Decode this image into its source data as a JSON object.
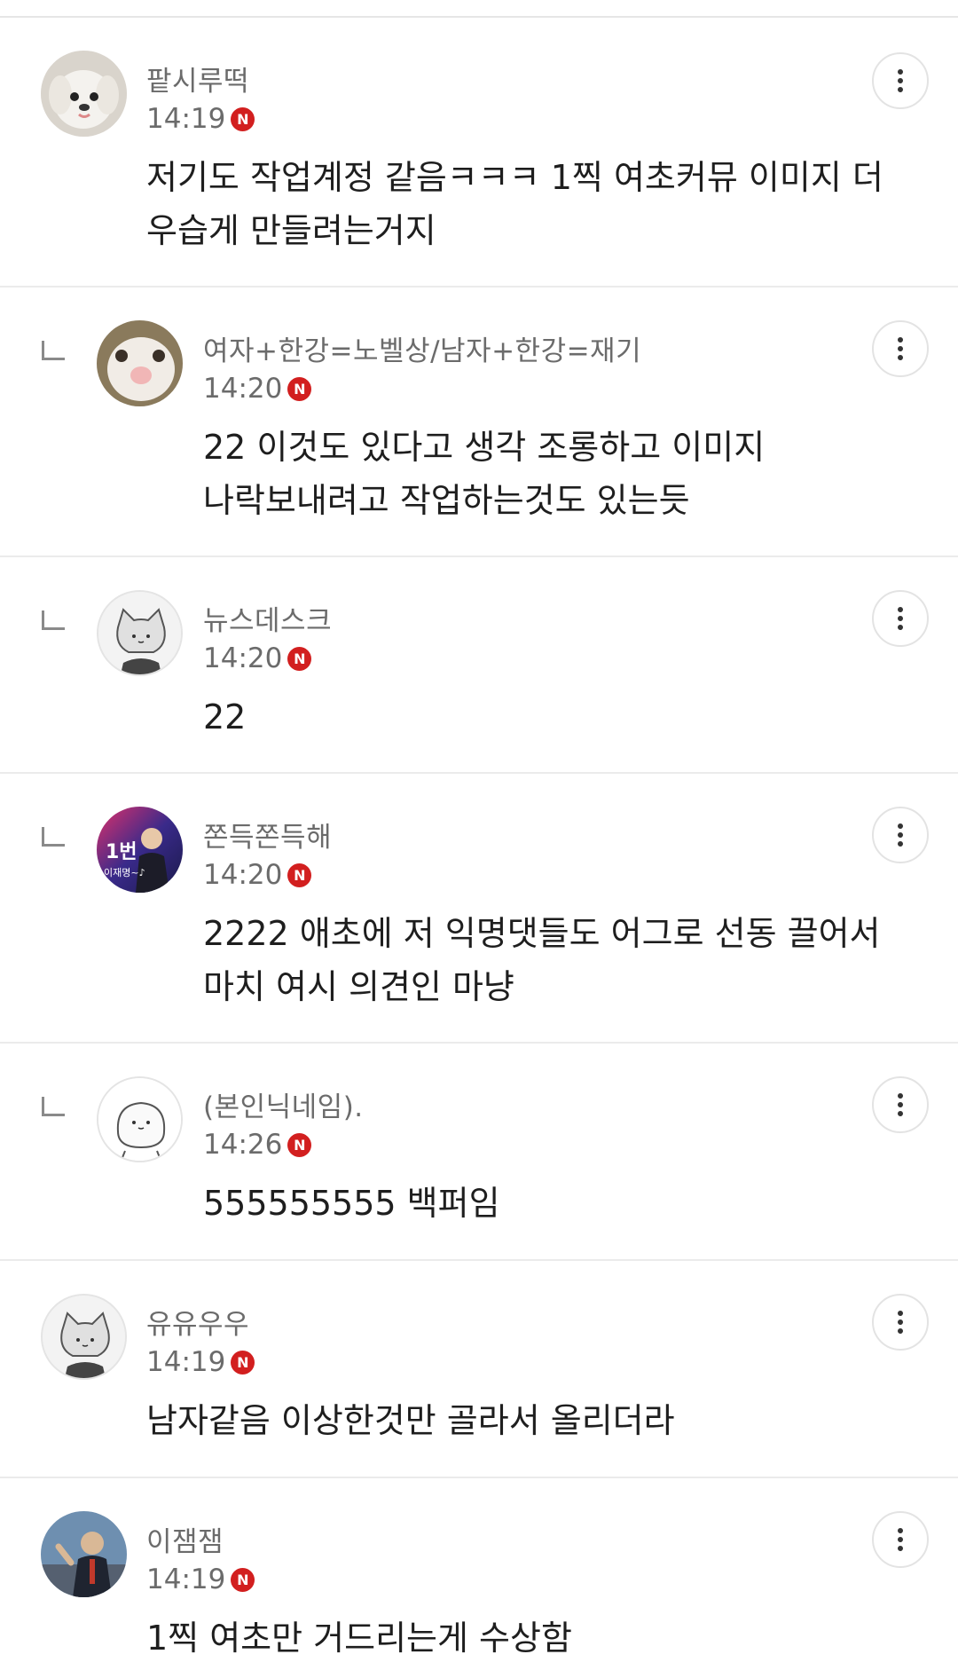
{
  "comments": [
    {
      "author": "팥시루떡",
      "time": "14:19",
      "badge": "N",
      "lines": [
        "저기도 작업계정 같음ㅋㅋㅋ 1찍 여초커뮤 이미지 더",
        "우습게 만들려는거지"
      ]
    },
    {
      "author": "여자+한강=노벨상/남자+한강=재기",
      "time": "14:20",
      "badge": "N",
      "lines": [
        "22 이것도 있다고 생각 조롱하고 이미지",
        "나락보내려고 작업하는것도 있는듯"
      ]
    },
    {
      "author": "뉴스데스크",
      "time": "14:20",
      "badge": "N",
      "lines": [
        "22"
      ]
    },
    {
      "author": "쫀득쫀득해",
      "time": "14:20",
      "badge": "N",
      "lines": [
        "2222 애초에 저 익명댓들도 어그로 선동 끌어서",
        "마치 여시 의견인 마냥"
      ]
    },
    {
      "author": "(본인닉네임).",
      "time": "14:26",
      "badge": "N",
      "lines": [
        "555555555 백퍼임"
      ]
    },
    {
      "author": "유유우우",
      "time": "14:19",
      "badge": "N",
      "lines": [
        "남자같음 이상한것만 골라서 올리더라"
      ]
    },
    {
      "author": "이잼잼",
      "time": "14:19",
      "badge": "N",
      "lines": [
        "1찍 여초만 거드리는게 수상함"
      ]
    }
  ],
  "avatar_badge_text": "1번",
  "avatar_caption": "이재명~♪",
  "colors": {
    "new_badge": "#d21f1f",
    "divider": "#ebebeb",
    "meta_text": "#6b6b6b"
  },
  "icons": {
    "more": "more-vertical-icon",
    "reply": "reply-indicator-icon"
  }
}
